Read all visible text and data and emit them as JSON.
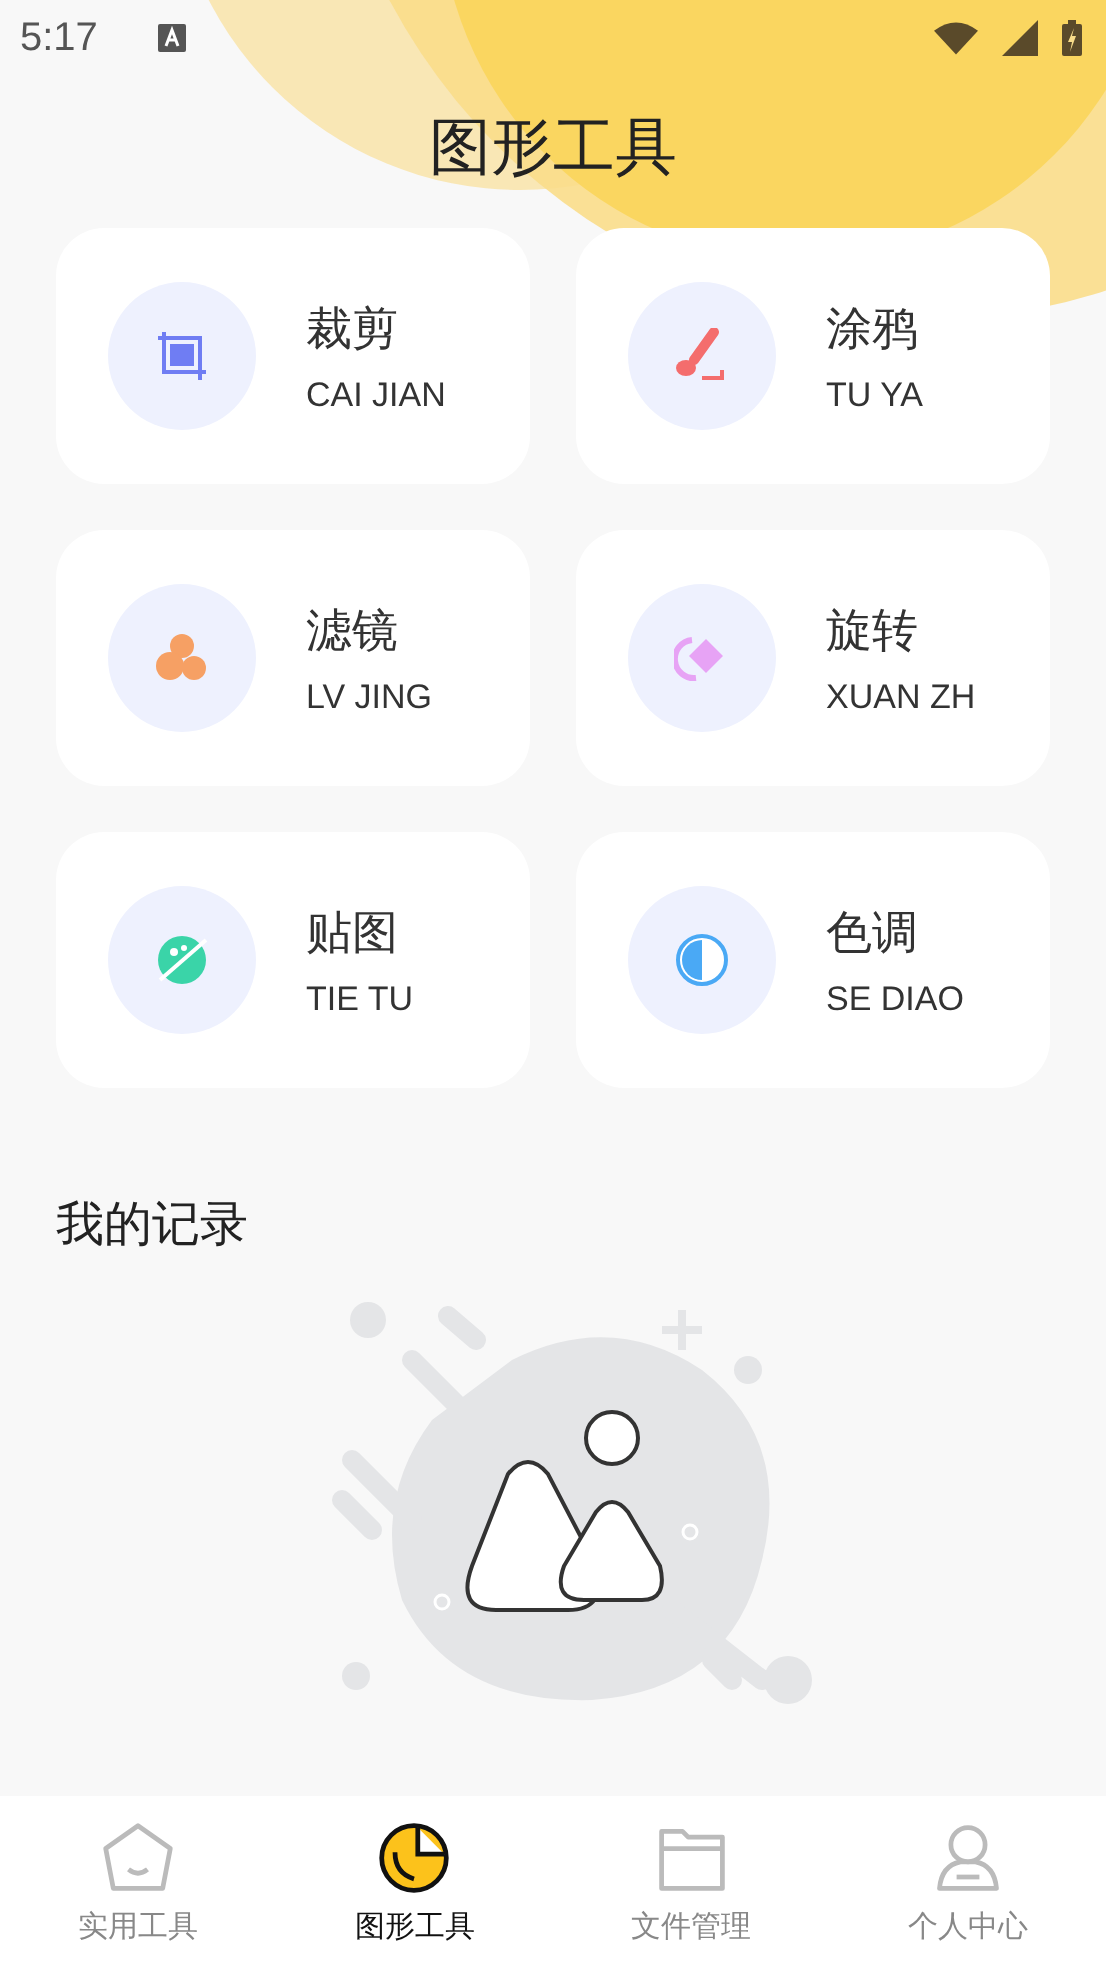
{
  "status_bar": {
    "time": "5:17"
  },
  "title": "图形工具",
  "tools": [
    {
      "kind": "crop",
      "name": "裁剪",
      "pinyin": "CAI JIAN"
    },
    {
      "kind": "brush",
      "name": "涂鸦",
      "pinyin": "TU YA"
    },
    {
      "kind": "filter",
      "name": "滤镜",
      "pinyin": "LV JING"
    },
    {
      "kind": "rotate",
      "name": "旋转",
      "pinyin": "XUAN ZH"
    },
    {
      "kind": "sticker",
      "name": "贴图",
      "pinyin": "TIE TU"
    },
    {
      "kind": "tone",
      "name": "色调",
      "pinyin": "SE DIAO"
    }
  ],
  "records": {
    "title": "我的记录"
  },
  "nav": [
    {
      "kind": "home",
      "label": "实用工具",
      "selected": false
    },
    {
      "kind": "chart",
      "label": "图形工具",
      "selected": true
    },
    {
      "kind": "folder",
      "label": "文件管理",
      "selected": false
    },
    {
      "kind": "person",
      "label": "个人中心",
      "selected": false
    }
  ]
}
